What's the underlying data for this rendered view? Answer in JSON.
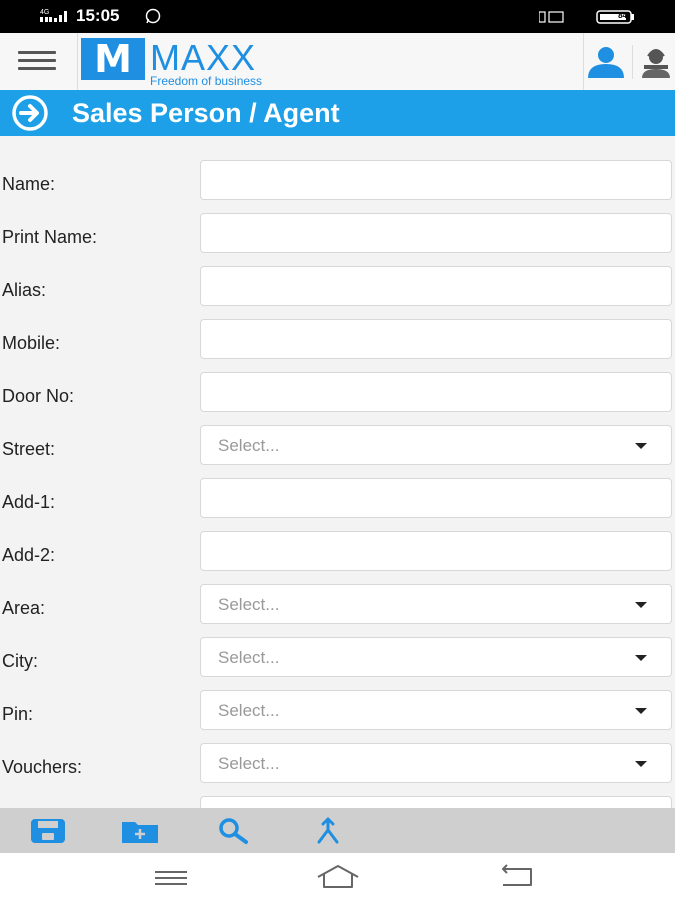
{
  "status_bar": {
    "time": "15:05",
    "network": "4G",
    "battery": "84"
  },
  "header": {
    "logo_letter": "M",
    "logo_name": "MAXX",
    "logo_tagline": "Freedom of business"
  },
  "page": {
    "title": "Sales Person / Agent"
  },
  "form": {
    "fields": [
      {
        "label": "Name:",
        "type": "text",
        "value": ""
      },
      {
        "label": "Print Name:",
        "type": "text",
        "value": ""
      },
      {
        "label": "Alias:",
        "type": "text",
        "value": ""
      },
      {
        "label": "Mobile:",
        "type": "text",
        "value": ""
      },
      {
        "label": "Door No:",
        "type": "text",
        "value": ""
      },
      {
        "label": "Street:",
        "type": "select",
        "placeholder": "Select..."
      },
      {
        "label": "Add-1:",
        "type": "text",
        "value": ""
      },
      {
        "label": "Add-2:",
        "type": "text",
        "value": ""
      },
      {
        "label": "Area:",
        "type": "select",
        "placeholder": "Select..."
      },
      {
        "label": "City:",
        "type": "select",
        "placeholder": "Select..."
      },
      {
        "label": "Pin:",
        "type": "select",
        "placeholder": "Select..."
      },
      {
        "label": "Vouchers:",
        "type": "select",
        "placeholder": "Select..."
      }
    ]
  },
  "toolbar": {
    "icons": [
      "save-icon",
      "new-folder-icon",
      "search-icon",
      "merge-icon"
    ]
  },
  "colors": {
    "brand": "#1e8fe1",
    "title_bar": "#1ea0e8",
    "toolbar_icon": "#1e8fe1"
  }
}
